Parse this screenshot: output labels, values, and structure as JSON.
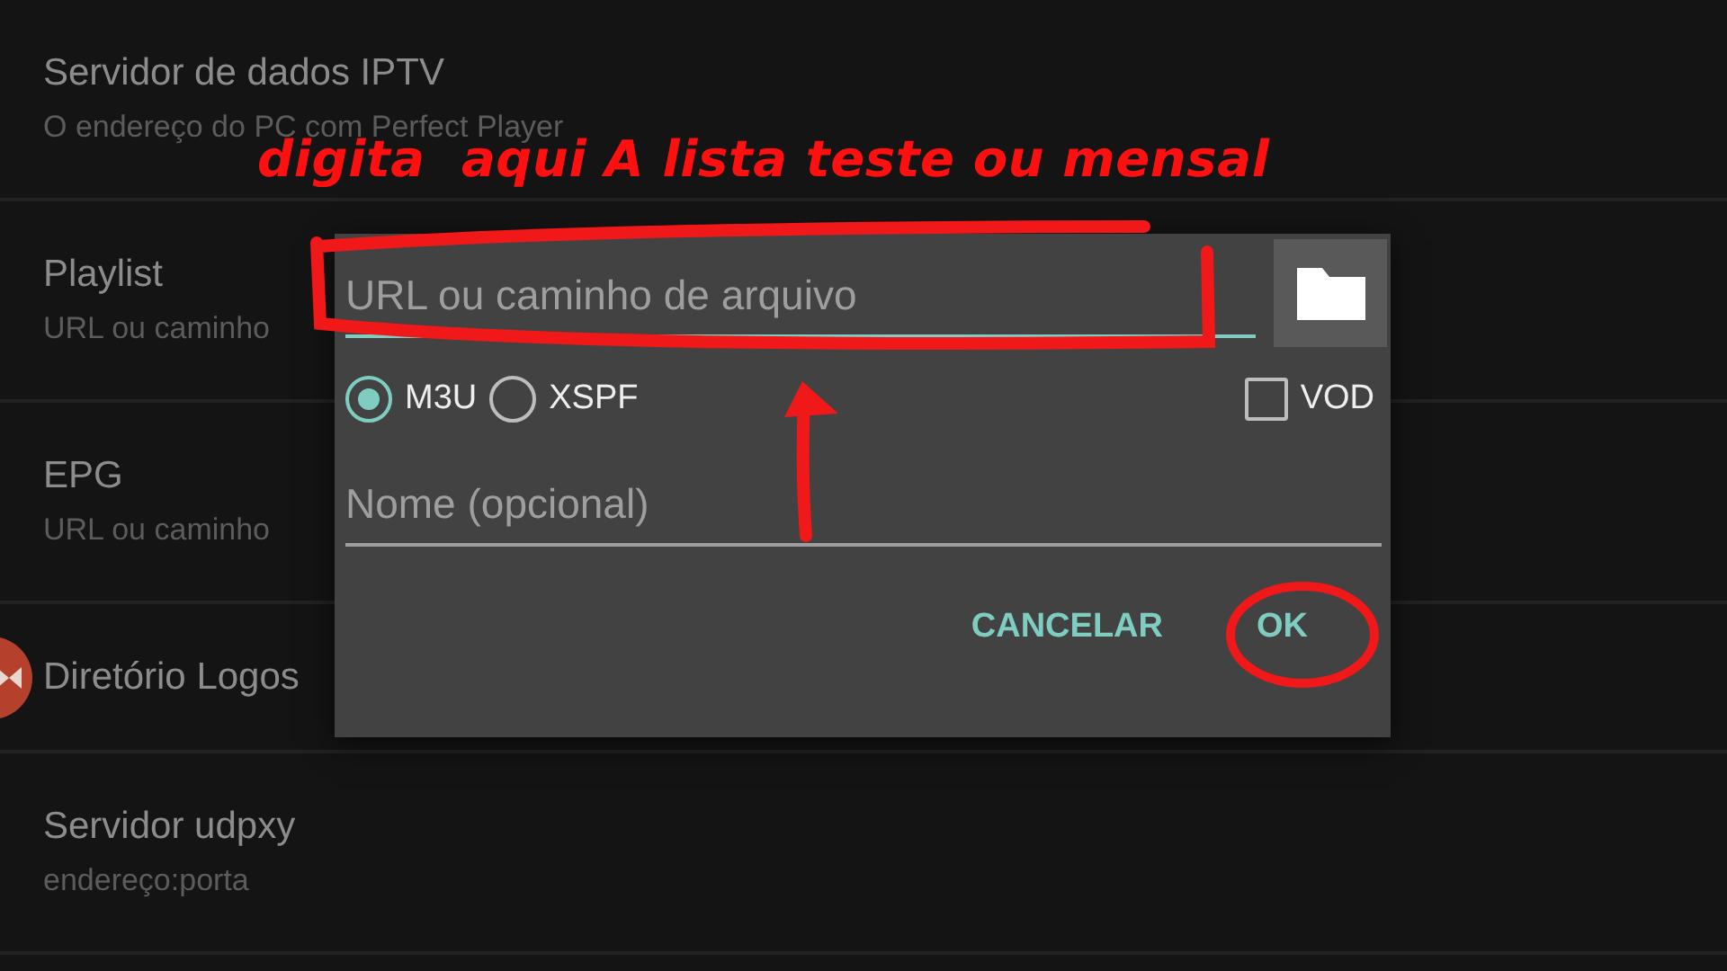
{
  "settings": [
    {
      "title": "Servidor de dados IPTV",
      "subtitle": "O endereço do PC com Perfect Player"
    },
    {
      "title": "Playlist",
      "subtitle": "URL ou caminho"
    },
    {
      "title": "EPG",
      "subtitle": "URL ou caminho"
    },
    {
      "title": "Diretório Logos"
    },
    {
      "title": "Servidor udpxy",
      "subtitle": "endereço:porta"
    }
  ],
  "dialog": {
    "url_field": {
      "placeholder": "URL ou caminho de arquivo",
      "focused": true
    },
    "formats": [
      {
        "label": "M3U",
        "selected": true
      },
      {
        "label": "XSPF",
        "selected": false
      }
    ],
    "vod": {
      "label": "VOD",
      "checked": false
    },
    "name_field": {
      "placeholder": "Nome (opcional)",
      "focused": false
    },
    "buttons": [
      {
        "label": "CANCELAR"
      },
      {
        "label": "OK"
      }
    ]
  },
  "annotation": {
    "text": "digita  aqui A lista teste ou mensal"
  }
}
